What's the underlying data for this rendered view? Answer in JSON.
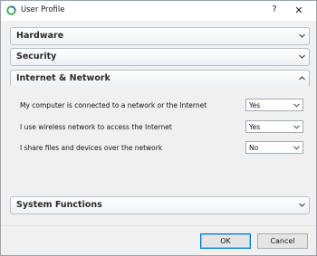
{
  "window": {
    "title": "User Profile",
    "help_label": "?",
    "close_label": "✕"
  },
  "panels": {
    "hardware": {
      "label": "Hardware",
      "expanded": false
    },
    "security": {
      "label": "Security",
      "expanded": false
    },
    "internet": {
      "label": "Internet & Network",
      "expanded": true
    },
    "system": {
      "label": "System Functions",
      "expanded": false
    }
  },
  "internet_rows": [
    {
      "label": "My computer is connected to a network or the Internet",
      "value": "Yes"
    },
    {
      "label": "I use wireless network to access the Internet",
      "value": "Yes"
    },
    {
      "label": "I share files and devices over the network",
      "value": "No"
    }
  ],
  "buttons": {
    "ok": "OK",
    "cancel": "Cancel"
  },
  "colors": {
    "accent": "#0078d7",
    "panel_border": "#b9c0c8",
    "icon_green": "#2fa84f"
  },
  "icons": {
    "app": "app-status-icon",
    "collapsed": "chevron-down-icon",
    "expanded": "chevron-up-icon",
    "dropdown": "dropdown-arrow-icon"
  }
}
